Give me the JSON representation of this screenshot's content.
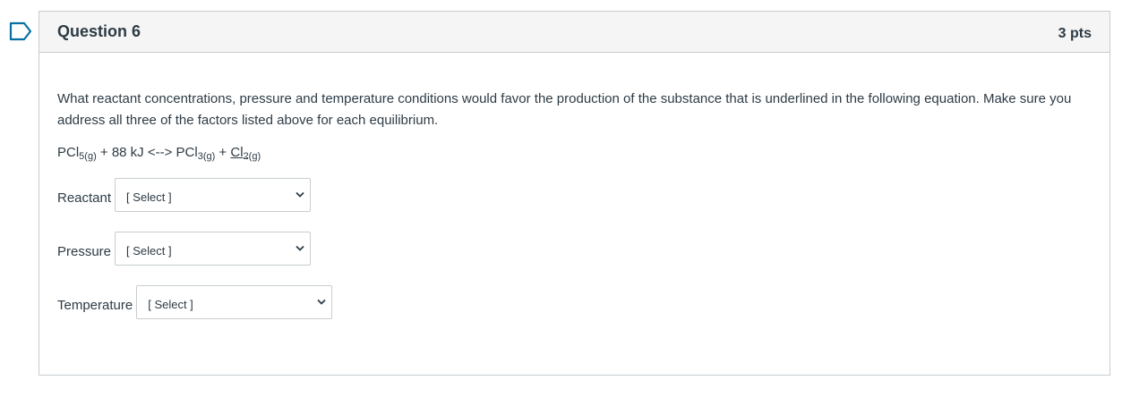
{
  "question": {
    "title": "Question 6",
    "points": "3 pts",
    "prompt": "What reactant concentrations, pressure and temperature conditions would favor the production of the substance that is underlined in the following equation.  Make sure you address all three of the factors listed above for each equilibrium.",
    "equation": {
      "term1": "PCl",
      "term1_sub": "5(g)",
      "middle": " + 88 kJ <--> ",
      "term2": "PCl",
      "term2_sub": "3(g)",
      "plus": " + ",
      "term3": "Cl",
      "term3_sub": "2(g)"
    },
    "answers": [
      {
        "label": "Reactant",
        "selected": "[ Select ]"
      },
      {
        "label": "Pressure",
        "selected": "[ Select ]"
      },
      {
        "label": "Temperature",
        "selected": "[ Select ]"
      }
    ]
  },
  "icons": {
    "flag": "flag-question-icon",
    "caret": "chevron-down-icon"
  },
  "colors": {
    "flag_accent": "#0770a3",
    "header_bg": "#f5f5f5",
    "border": "#c7cdd1",
    "text": "#2d3b45"
  }
}
